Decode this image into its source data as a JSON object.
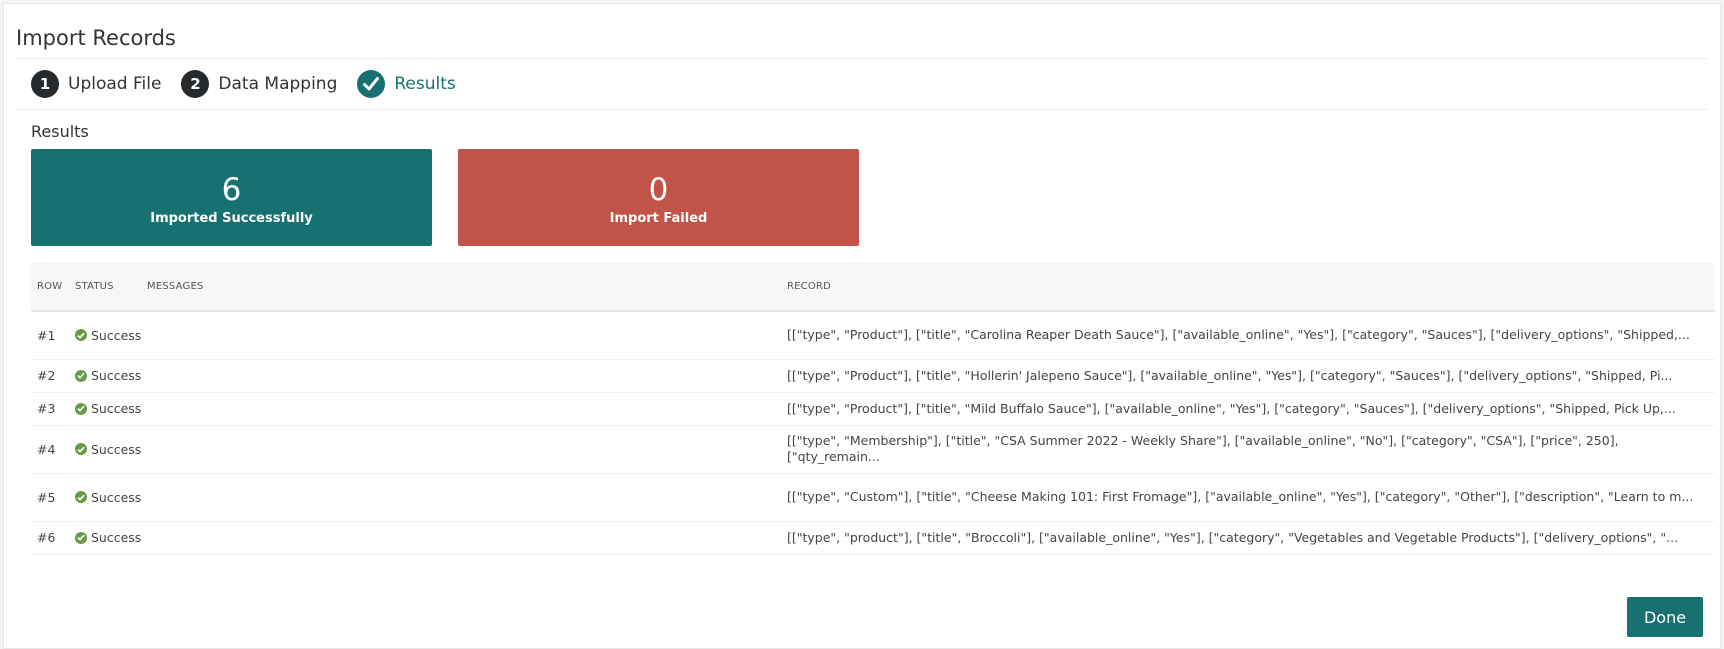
{
  "page": {
    "title": "Import Records"
  },
  "stepper": {
    "steps": [
      {
        "number": "1",
        "label": "Upload File",
        "state": "done"
      },
      {
        "number": "2",
        "label": "Data Mapping",
        "state": "done"
      },
      {
        "number": "✓",
        "label": "Results",
        "state": "active"
      }
    ]
  },
  "results": {
    "title": "Results",
    "success": {
      "count": "6",
      "label": "Imported Successfully",
      "color": "#167170"
    },
    "failed": {
      "count": "0",
      "label": "Import Failed",
      "color": "#c15349"
    }
  },
  "table": {
    "headers": {
      "row": "ROW",
      "status": "STATUS",
      "messages": "MESSAGES",
      "record": "RECORD"
    },
    "rows": [
      {
        "row": "#1",
        "status": "Success",
        "messages": "",
        "record": "[[\"type\", \"Product\"], [\"title\", \"Carolina Reaper Death Sauce\"], [\"available_online\", \"Yes\"], [\"category\", \"Sauces\"], [\"delivery_options\", \"Shipped,..."
      },
      {
        "row": "#2",
        "status": "Success",
        "messages": "",
        "record": "[[\"type\", \"Product\"], [\"title\", \"Hollerin' Jalepeno Sauce\"], [\"available_online\", \"Yes\"], [\"category\", \"Sauces\"], [\"delivery_options\", \"Shipped, Pi..."
      },
      {
        "row": "#3",
        "status": "Success",
        "messages": "",
        "record": "[[\"type\", \"Product\"], [\"title\", \"Mild Buffalo Sauce\"], [\"available_online\", \"Yes\"], [\"category\", \"Sauces\"], [\"delivery_options\", \"Shipped, Pick Up,..."
      },
      {
        "row": "#4",
        "status": "Success",
        "messages": "",
        "record": "[[\"type\", \"Membership\"], [\"title\", \"CSA Summer 2022 - Weekly Share\"], [\"available_online\", \"No\"], [\"category\", \"CSA\"], [\"price\", 250], [\"qty_remain..."
      },
      {
        "row": "#5",
        "status": "Success",
        "messages": "",
        "record": "[[\"type\", \"Custom\"], [\"title\", \"Cheese Making 101: First Fromage\"], [\"available_online\", \"Yes\"], [\"category\", \"Other\"], [\"description\", \"Learn to m..."
      },
      {
        "row": "#6",
        "status": "Success",
        "messages": "",
        "record": "[[\"type\", \"product\"], [\"title\", \"Broccoli\"], [\"available_online\", \"Yes\"], [\"category\", \"Vegetables and Vegetable Products\"], [\"delivery_options\", \"..."
      }
    ]
  },
  "actions": {
    "done_label": "Done"
  },
  "icons": {
    "step_done": "number-circle",
    "step_active": "check-icon",
    "row_status": "check-circle-icon"
  }
}
